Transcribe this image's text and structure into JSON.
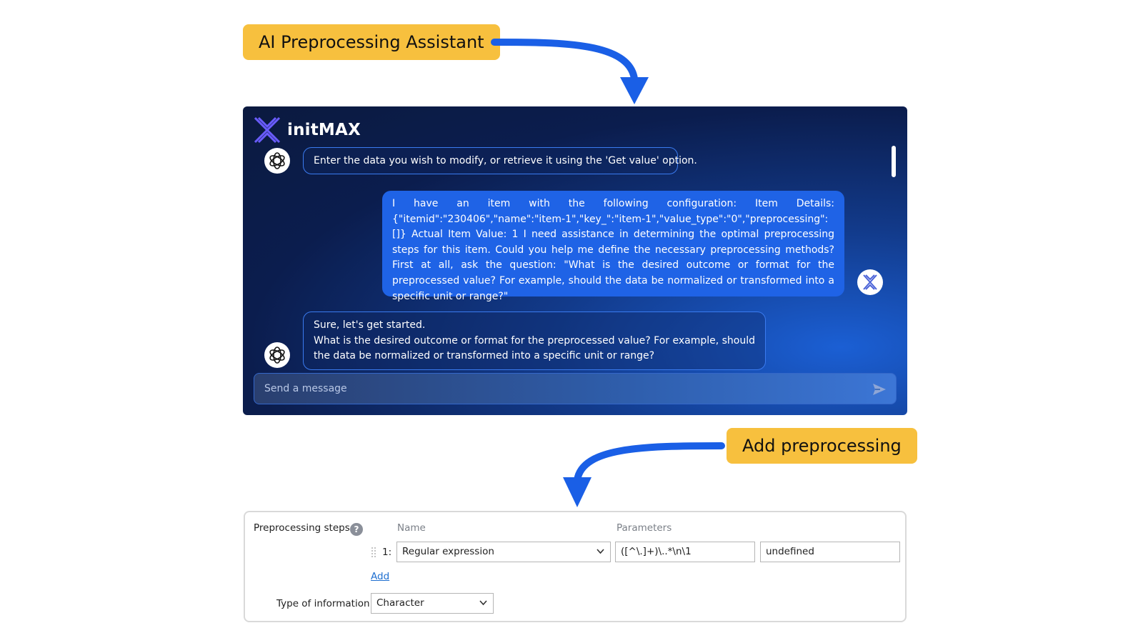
{
  "callouts": {
    "top": "AI Preprocessing Assistant",
    "bottom": "Add preprocessing"
  },
  "chat": {
    "brand": "initMAX",
    "messages": [
      {
        "role": "assistant",
        "text": "Enter the data you wish to modify, or retrieve it using the 'Get value' option."
      },
      {
        "role": "user",
        "text": "I have an item with the following configuration: Item Details: {\"itemid\":\"230406\",\"name\":\"item-1\",\"key_\":\"item-1\",\"value_type\":\"0\",\"preprocessing\":[]} Actual Item Value: 1 I need assistance in determining the optimal preprocessing steps for this item. Could you help me define the necessary preprocessing methods? First at all, ask the question: \"What is the desired outcome or format for the preprocessed value? For example, should the data be normalized or transformed into a specific unit or range?\""
      },
      {
        "role": "assistant",
        "line1": "Sure, let's get started.",
        "line2": "What is the desired outcome or format for the preprocessed value? For example, should the data be normalized or transformed into a specific unit or range?"
      }
    ],
    "input_placeholder": "Send a message"
  },
  "preprocessing": {
    "steps_label": "Preprocessing steps",
    "help_glyph": "?",
    "columns": {
      "name": "Name",
      "parameters": "Parameters"
    },
    "step": {
      "index": "1:",
      "name": "Regular expression",
      "param1": "([^\\.]+)\\..*\\n\\1",
      "param2": "undefined"
    },
    "add_label": "Add",
    "type_label": "Type of information",
    "type_value": "Character"
  },
  "colors": {
    "callout": "#f7c03e",
    "arrow": "#1a5fe6",
    "user_bubble": "#1f63e6",
    "link": "#1f6fd0"
  }
}
